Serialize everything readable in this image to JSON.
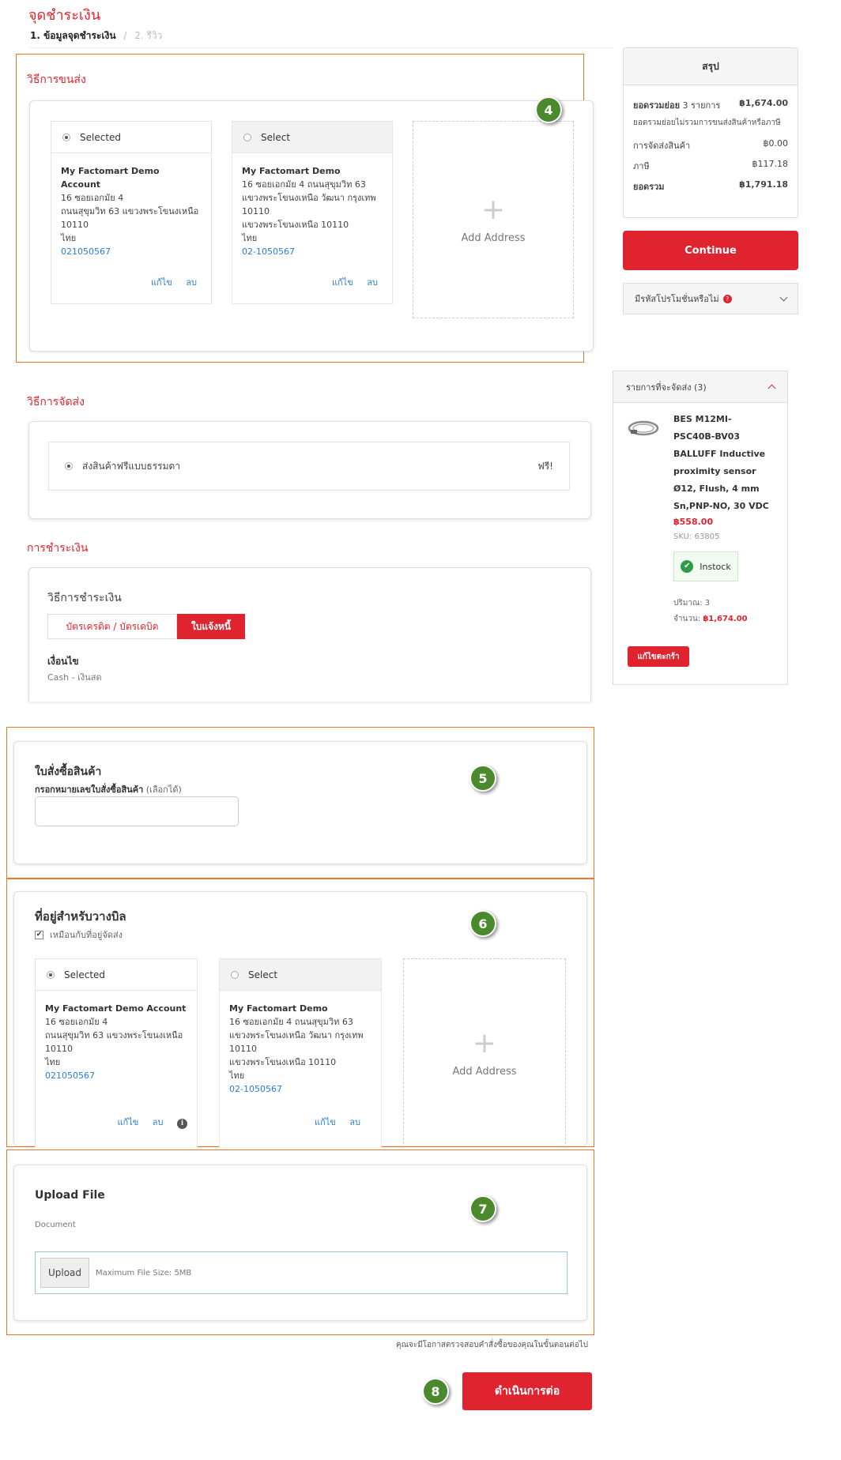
{
  "page": {
    "title": "จุดชำระเงิน"
  },
  "steps": {
    "step1": "1. ข้อมูลจุดชำระเงิน",
    "sep": "/",
    "step2": "2. รีวิว"
  },
  "shipping_method": {
    "title": "วิธีการขนส่ง",
    "badge": "4",
    "addresses": [
      {
        "header": "Selected",
        "selected": true,
        "name": "My Factomart Demo Account",
        "lines": [
          "16 ซอยเอกมัย 4",
          "ถนนสุขุมวิท 63 แขวงพระโขนงเหนือ",
          "10110",
          "ไทย"
        ],
        "phone": "021050567",
        "edit": "แก้ไข",
        "delete": "ลบ"
      },
      {
        "header": "Select",
        "selected": false,
        "name": "My Factomart Demo",
        "lines": [
          "16 ซอยเอกมัย 4 ถนนสุขุมวิท 63",
          "แขวงพระโขนงเหนือ วัฒนา กรุงเทพ",
          "10110",
          "แขวงพระโขนงเหนือ 10110",
          "ไทย"
        ],
        "phone": "02-1050567",
        "edit": "แก้ไข",
        "delete": "ลบ"
      }
    ],
    "add_address": "Add Address"
  },
  "delivery": {
    "title": "วิธีการจัดส่ง",
    "option": "ส่งสินค้าฟรีแบบธรรมดา",
    "price": "ฟรี!"
  },
  "payment": {
    "title": "การชำระเงิน",
    "subtitle": "วิธีการชำระเงิน",
    "tabs": [
      "บัตรเครดิต / บัตรเดบิต",
      "ใบแจ้งหนี้"
    ],
    "terms_label": "เงื่อนไข",
    "terms_value": "Cash - เงินสด"
  },
  "purchase_order": {
    "title": "ใบสั่งซื้อสินค้า",
    "label": "กรอกหมายเลขใบสั่งซื้อสินค้า",
    "optional": "(เลือกได้)",
    "value": "",
    "badge": "5"
  },
  "billing": {
    "title": "ที่อยู่สำหรับวางบิล",
    "same_as_shipping": "เหมือนกับที่อยู่จัดส่ง",
    "badge": "6",
    "addresses": [
      {
        "header": "Selected",
        "name": "My Factomart Demo Account",
        "lines": [
          "16 ซอยเอกมัย 4",
          "ถนนสุขุมวิท 63 แขวงพระโขนงเหนือ",
          "10110",
          "ไทย"
        ],
        "phone": "021050567",
        "edit": "แก้ไข",
        "delete": "ลบ"
      },
      {
        "header": "Select",
        "name": "My Factomart Demo",
        "lines": [
          "16 ซอยเอกมัย 4 ถนนสุขุมวิท 63",
          "แขวงพระโขนงเหนือ วัฒนา กรุงเทพ",
          "10110",
          "แขวงพระโขนงเหนือ 10110",
          "ไทย"
        ],
        "phone": "02-1050567",
        "edit": "แก้ไข",
        "delete": "ลบ"
      }
    ],
    "add_address": "Add Address"
  },
  "upload": {
    "title": "Upload File",
    "doc_label": "Document",
    "button": "Upload",
    "hint": "Maximum File Size: 5MB",
    "badge": "7"
  },
  "footer": {
    "note": "คุณจะมีโอกาสตรวจสอบคำสั่งซื้อของคุณในขั้นตอนต่อไป",
    "proceed": "ดำเนินการต่อ",
    "badge": "8"
  },
  "summary": {
    "title": "สรุป",
    "subtotal_label": "ยอดรวมย่อย",
    "subtotal_items": "3 รายการ",
    "subtotal_value": "฿1,674.00",
    "note": "ยอดรวมย่อยไม่รวมการขนส่งสินค้าหรือภาษี",
    "shipping_label": "การจัดส่งสินค้า",
    "shipping_value": "฿0.00",
    "tax_label": "ภาษี",
    "tax_value": "฿117.18",
    "total_label": "ยอดรวม",
    "total_value": "฿1,791.18",
    "continue": "Continue",
    "promo": "มีรหัสโปรโมชั่นหรือไม่"
  },
  "cart": {
    "title": "รายการที่จะจัดส่ง (3)",
    "product_name": "BES M12MI-PSC40B-BV03 BALLUFF Inductive proximity sensor Ø12, Flush, 4 mm Sn,PNP-NO, 30 VDC",
    "price": "฿558.00",
    "sku": "SKU: 63805",
    "stock": "Instock",
    "qty": "ปริมาณ: 3",
    "amount_label": "จำนวน:",
    "amount_value": "฿1,674.00",
    "edit_cart": "แก้ไขตะกร้า"
  },
  "colors": {
    "brand": "#e0242f",
    "highlight": "#e8772a",
    "badge": "#4a8a2d",
    "link": "#2a7dd1"
  }
}
